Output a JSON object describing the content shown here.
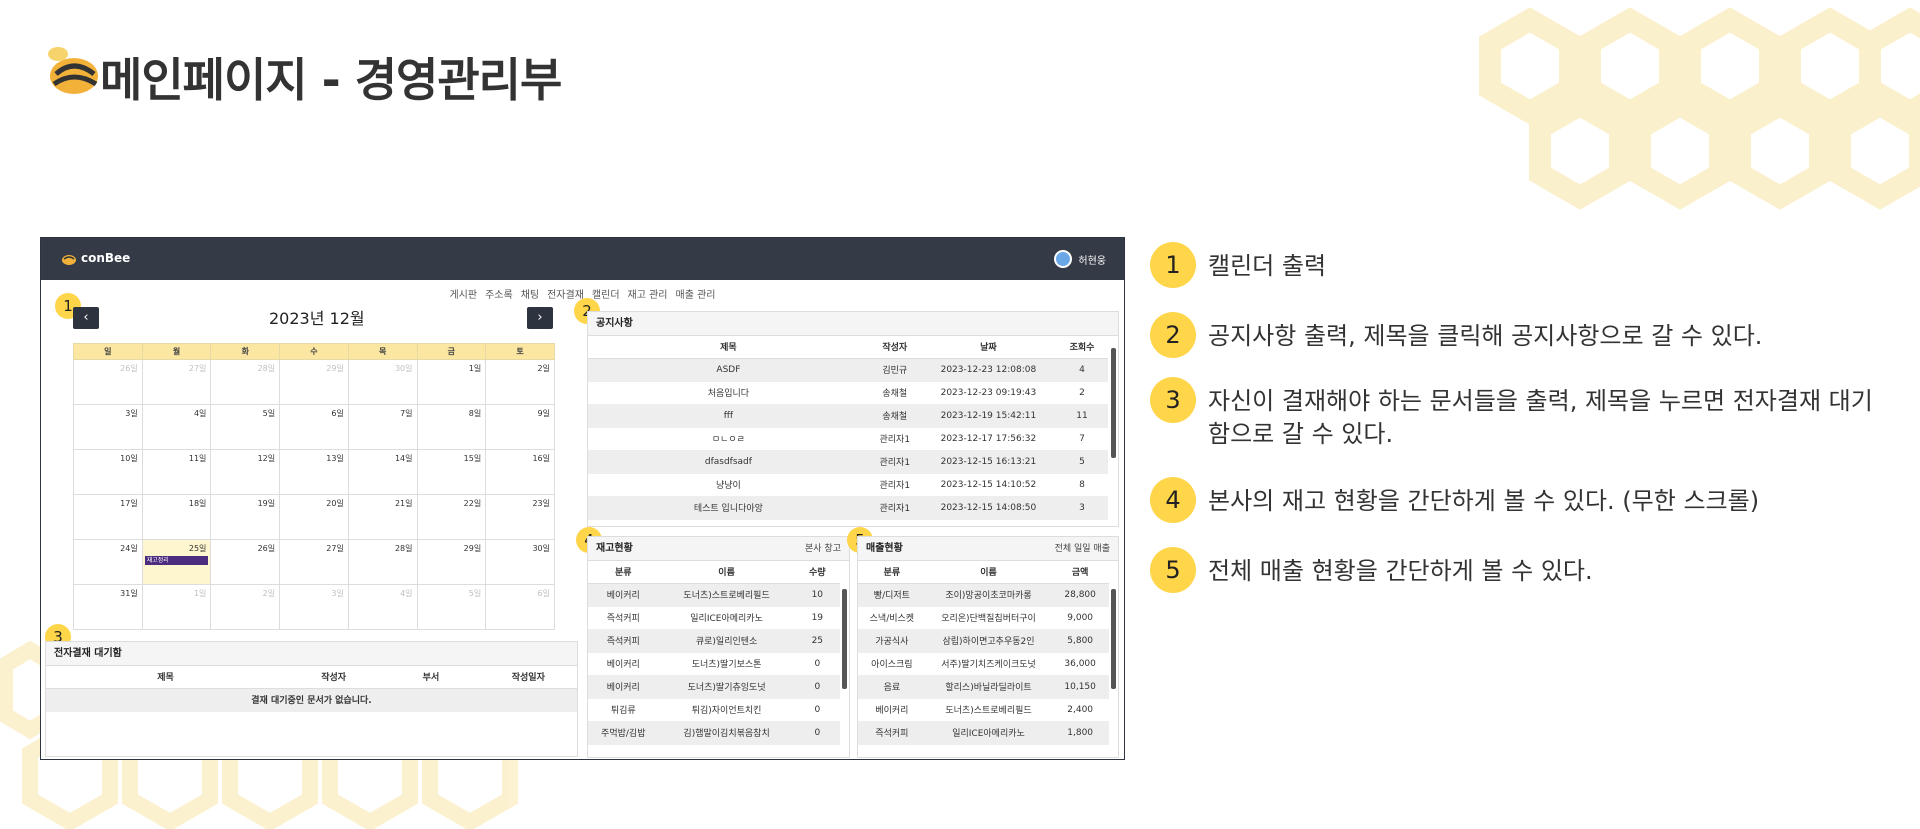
{
  "slide": {
    "title": "메인페이지 - 경영관리부"
  },
  "app": {
    "brand": "conBee",
    "user_name": "허현웅",
    "nav_links": [
      "게시판",
      "주소록",
      "채팅",
      "전자결재",
      "캘린더",
      "재고 관리",
      "매출 관리"
    ]
  },
  "calendar": {
    "badge": "1",
    "title": "2023년 12월",
    "prev_label": "‹",
    "next_label": "›",
    "weekdays": [
      "일",
      "월",
      "화",
      "수",
      "목",
      "금",
      "토"
    ],
    "weeks": [
      [
        "26일",
        "27일",
        "28일",
        "29일",
        "30일",
        "1일",
        "2일"
      ],
      [
        "3일",
        "4일",
        "5일",
        "6일",
        "7일",
        "8일",
        "9일"
      ],
      [
        "10일",
        "11일",
        "12일",
        "13일",
        "14일",
        "15일",
        "16일"
      ],
      [
        "17일",
        "18일",
        "19일",
        "20일",
        "21일",
        "22일",
        "23일"
      ],
      [
        "24일",
        "25일",
        "26일",
        "27일",
        "28일",
        "29일",
        "30일"
      ],
      [
        "31일",
        "1일",
        "2일",
        "3일",
        "4일",
        "5일",
        "6일"
      ]
    ],
    "event_label": "재고정리"
  },
  "notices": {
    "badge": "2",
    "title": "공지사항",
    "columns": [
      "제목",
      "작성자",
      "날짜",
      "조회수"
    ],
    "rows": [
      [
        "ASDF",
        "김민규",
        "2023-12-23 12:08:08",
        "4"
      ],
      [
        "처음입니다",
        "송채철",
        "2023-12-23 09:19:43",
        "2"
      ],
      [
        "fff",
        "송채철",
        "2023-12-19 15:42:11",
        "11"
      ],
      [
        "ㅁㄴㅇㄹ",
        "관리자1",
        "2023-12-17 17:56:32",
        "7"
      ],
      [
        "dfasdfsadf",
        "관리자1",
        "2023-12-15 16:13:21",
        "5"
      ],
      [
        "냥냥이",
        "관리자1",
        "2023-12-15 14:10:52",
        "8"
      ],
      [
        "테스트 입니다아앙",
        "관리자1",
        "2023-12-15 14:08:50",
        "3"
      ]
    ]
  },
  "approval": {
    "badge": "3",
    "title": "전자결재 대기함",
    "columns": [
      "제목",
      "작성자",
      "부서",
      "작성일자"
    ],
    "empty_text": "결재 대기중인 문서가 없습니다."
  },
  "inventory": {
    "badge": "4",
    "title": "재고현황",
    "right_label": "본사 창고",
    "columns": [
      "분류",
      "이름",
      "수량"
    ],
    "rows": [
      [
        "베이커리",
        "도너츠)스트로베리필드",
        "10"
      ],
      [
        "즉석커피",
        "일리ICE아메리카노",
        "19"
      ],
      [
        "즉석커피",
        "큐로)일리인텐소",
        "25"
      ],
      [
        "베이커리",
        "도너츠)딸기보스톤",
        "0"
      ],
      [
        "베이커리",
        "도너츠)딸기츄잉도넛",
        "0"
      ],
      [
        "튀김류",
        "튀김)자이언트치킨",
        "0"
      ],
      [
        "주먹밥/김밥",
        "김)햄말이김치볶음참치",
        "0"
      ]
    ]
  },
  "sales": {
    "badge": "5",
    "title": "매출현황",
    "right_label": "전체 일일 매출",
    "columns": [
      "분류",
      "이름",
      "금액"
    ],
    "rows": [
      [
        "빵/디저트",
        "조이)망공이초코마카롱",
        "28,800"
      ],
      [
        "스낵/비스켓",
        "오리온)단백질칩버터구이",
        "9,000"
      ],
      [
        "가공식사",
        "삼립)하이면고추우동2인",
        "5,800"
      ],
      [
        "아이스크림",
        "서주)딸기치즈케이크도넛",
        "36,000"
      ],
      [
        "음료",
        "할리스)바닐라딜라이트",
        "10,150"
      ],
      [
        "베이커리",
        "도너츠)스트로베리필드",
        "2,400"
      ],
      [
        "즉석커피",
        "일리ICE아메리카노",
        "1,800"
      ]
    ]
  },
  "steps": [
    {
      "num": "1",
      "text": "캘린더 출력"
    },
    {
      "num": "2",
      "text": "공지사항 출력, 제목을 클릭해 공지사항으로 갈 수 있다."
    },
    {
      "num": "3",
      "text": "자신이 결재해야 하는 문서들을 출력, 제목을 누르면 전자결재 대기함으로 갈 수 있다."
    },
    {
      "num": "4",
      "text": "본사의 재고 현황을 간단하게 볼 수 있다. (무한 스크롤)"
    },
    {
      "num": "5",
      "text": "전체 매출 현황을 간단하게 볼 수 있다."
    }
  ],
  "colors": {
    "accent": "#ffd54a",
    "navbar": "#343a46",
    "weekday_header": "#fbe7a1",
    "event": "#4b2c7e",
    "honeycomb": "#fbeec4"
  }
}
